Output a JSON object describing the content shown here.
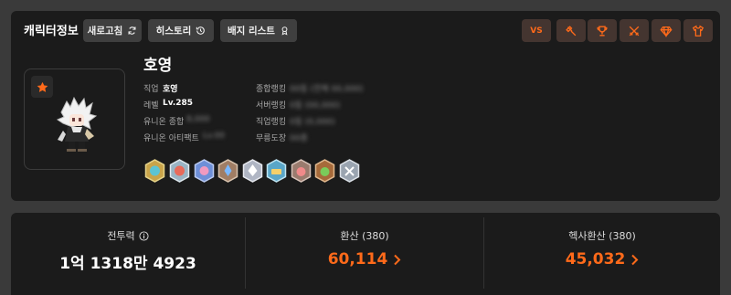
{
  "header": {
    "title": "캐릭터정보",
    "refresh_label": "새로고침",
    "history_label": "히스토리",
    "badge_list_label": "배지 리스트",
    "vs_label": "VS"
  },
  "character": {
    "name": "호영",
    "job_label": "직업",
    "job_value": "호영",
    "level_label": "레벨",
    "level_value": "Lv.285",
    "union_label": "유니온 종합",
    "union_value": "8,000",
    "artifact_label": "유니온 아티팩트",
    "artifact_value": "Lv.00",
    "overall_rank_label": "종합랭킹",
    "overall_rank_value": "00등 (전체 00,000)",
    "server_rank_label": "서버랭킹",
    "server_rank_value": "0등 (00,000)",
    "job_rank_label": "직업랭킹",
    "job_rank_value": "0등 (0,000)",
    "dojang_label": "무릉도장",
    "dojang_value": "00층"
  },
  "stats": {
    "combat_power_label": "전투력",
    "combat_power_value": "1억 1318만 4923",
    "hwansan_label": "환산 (380)",
    "hwansan_value": "60,114",
    "hexa_hwansan_label": "헥사환산 (380)",
    "hexa_hwansan_value": "45,032"
  },
  "colors": {
    "accent": "#ff6a1a",
    "panel": "#1b1b1b",
    "background": "#3a3a3a"
  }
}
